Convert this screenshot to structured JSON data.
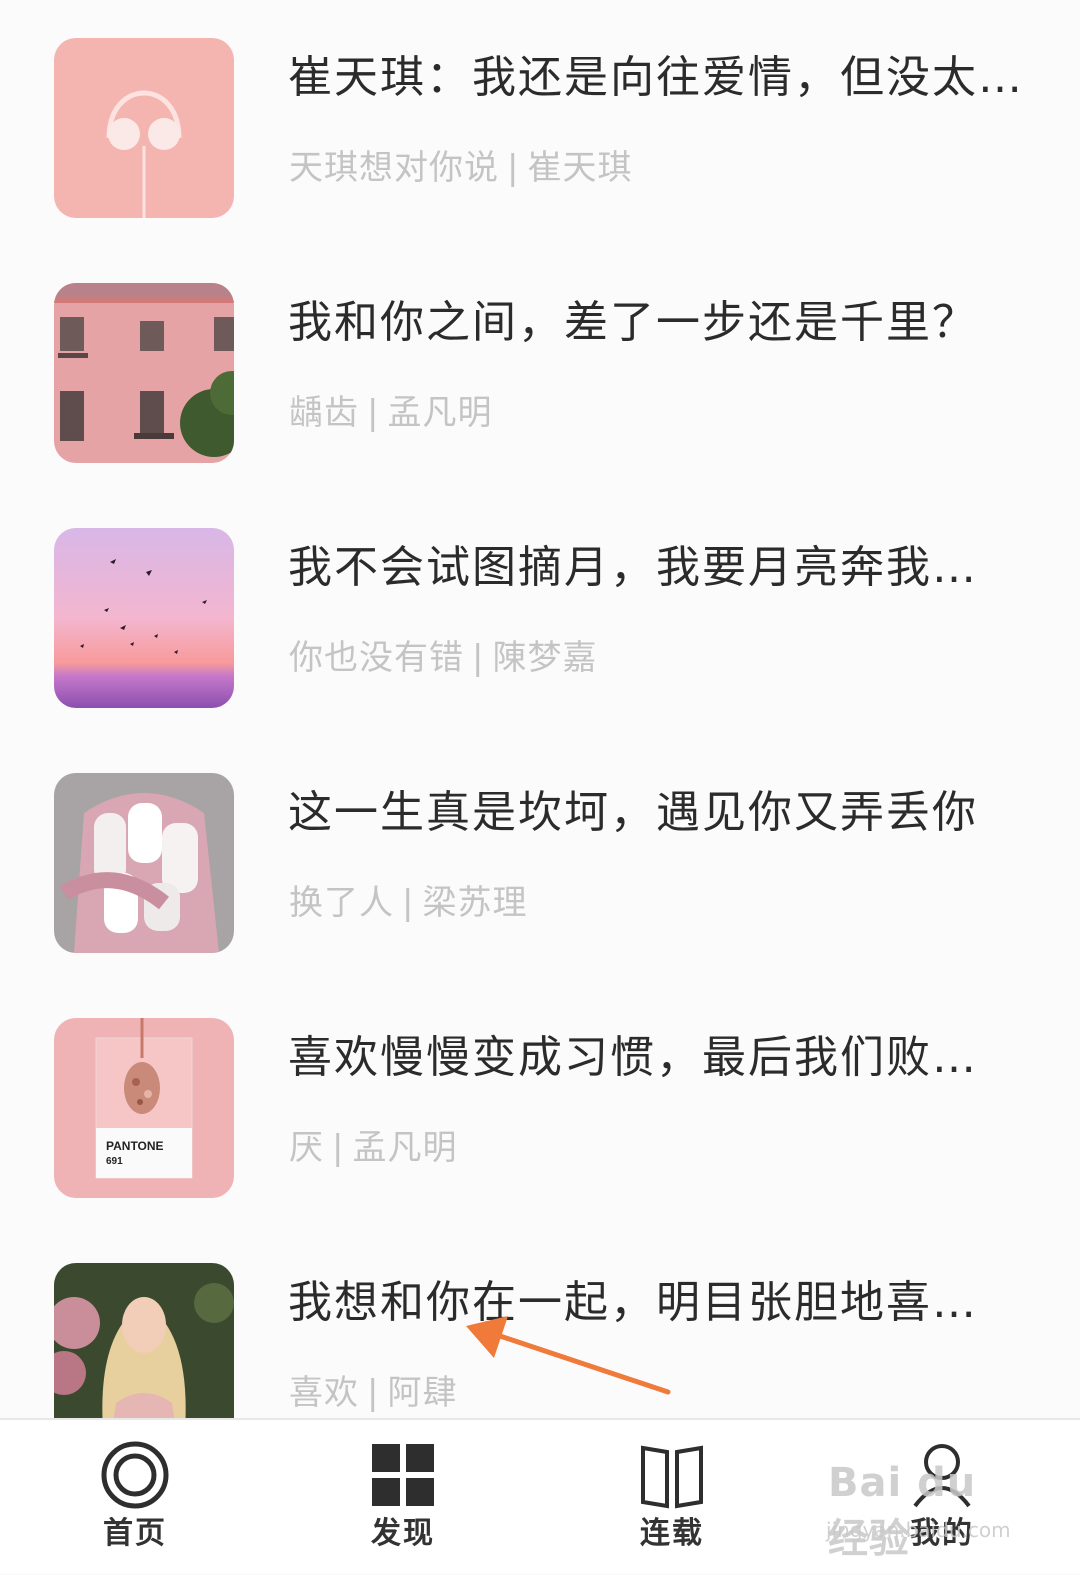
{
  "feed": {
    "items": [
      {
        "title": "崔天琪：我还是向往爱情，但没太…",
        "tag": "天琪想对你说",
        "author": "崔天琪",
        "thumb": "headphones-image"
      },
      {
        "title": "我和你之间，差了一步还是千里？",
        "tag": "龋齿",
        "author": "孟凡明",
        "thumb": "pink-building-image"
      },
      {
        "title": "我不会试图摘月，我要月亮奔我…",
        "tag": "你也没有错",
        "author": "陳梦嘉",
        "thumb": "sunset-birds-image"
      },
      {
        "title": "这一生真是坎坷，遇见你又弄丢你",
        "tag": "换了人",
        "author": "梁苏理",
        "thumb": "person-pink-hoodie-image"
      },
      {
        "title": "喜欢慢慢变成习惯，最后我们败…",
        "tag": "厌",
        "author": "孟凡明",
        "thumb": "pantone-card-image",
        "thumb_text": {
          "line1": "PANTONE",
          "line2": "691"
        }
      },
      {
        "title": "我想和你在一起，明目张胆地喜…",
        "tag": "喜欢",
        "author": "阿肆",
        "thumb": "blonde-woman-image"
      }
    ],
    "separator": "|"
  },
  "tabbar": {
    "home": {
      "label": "首页",
      "icon": "home-circle-icon"
    },
    "discover": {
      "label": "发现",
      "icon": "grid-icon"
    },
    "serial": {
      "label": "连载",
      "icon": "book-icon"
    },
    "mine": {
      "label": "我的",
      "icon": "person-icon"
    }
  },
  "watermark": {
    "main": "Bai du 经验",
    "sub": "jingyan.baidu.com"
  },
  "colors": {
    "title": "#2b2b2b",
    "meta": "#c4c4c4",
    "arrow": "#f07a3a",
    "background": "#fbfbfb"
  }
}
